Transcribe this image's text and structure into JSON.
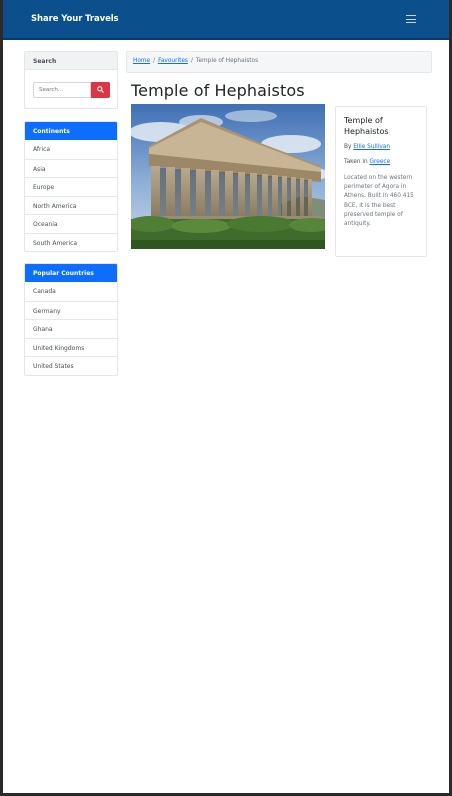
{
  "navbar": {
    "brand": "Share Your Travels"
  },
  "search": {
    "header": "Search",
    "placeholder": "Search..."
  },
  "continents": {
    "header": "Continents",
    "items": [
      "Africa",
      "Asia",
      "Europe",
      "North America",
      "Oceania",
      "South America"
    ]
  },
  "countries": {
    "header": "Popular Countries",
    "items": [
      "Canada",
      "Germany",
      "Ghana",
      "United Kingdoms",
      "United States"
    ]
  },
  "breadcrumb": {
    "home": "Home",
    "favourites": "Favourites",
    "current": "Temple of Hephaistos"
  },
  "photo": {
    "title": "Temple of Hephaistos",
    "by_prefix": "By",
    "author": "Ellie Sullivan",
    "taken_prefix": "Taken in",
    "country": "Greece",
    "description": "Located on the western perimeter of Agora in Athens. Built in 460 415 BCE, it is the best preserved temple of antiquity."
  },
  "colors": {
    "navbar": "#0b4f8c",
    "accent": "#0d6efd",
    "search_button": "#dc3545"
  }
}
